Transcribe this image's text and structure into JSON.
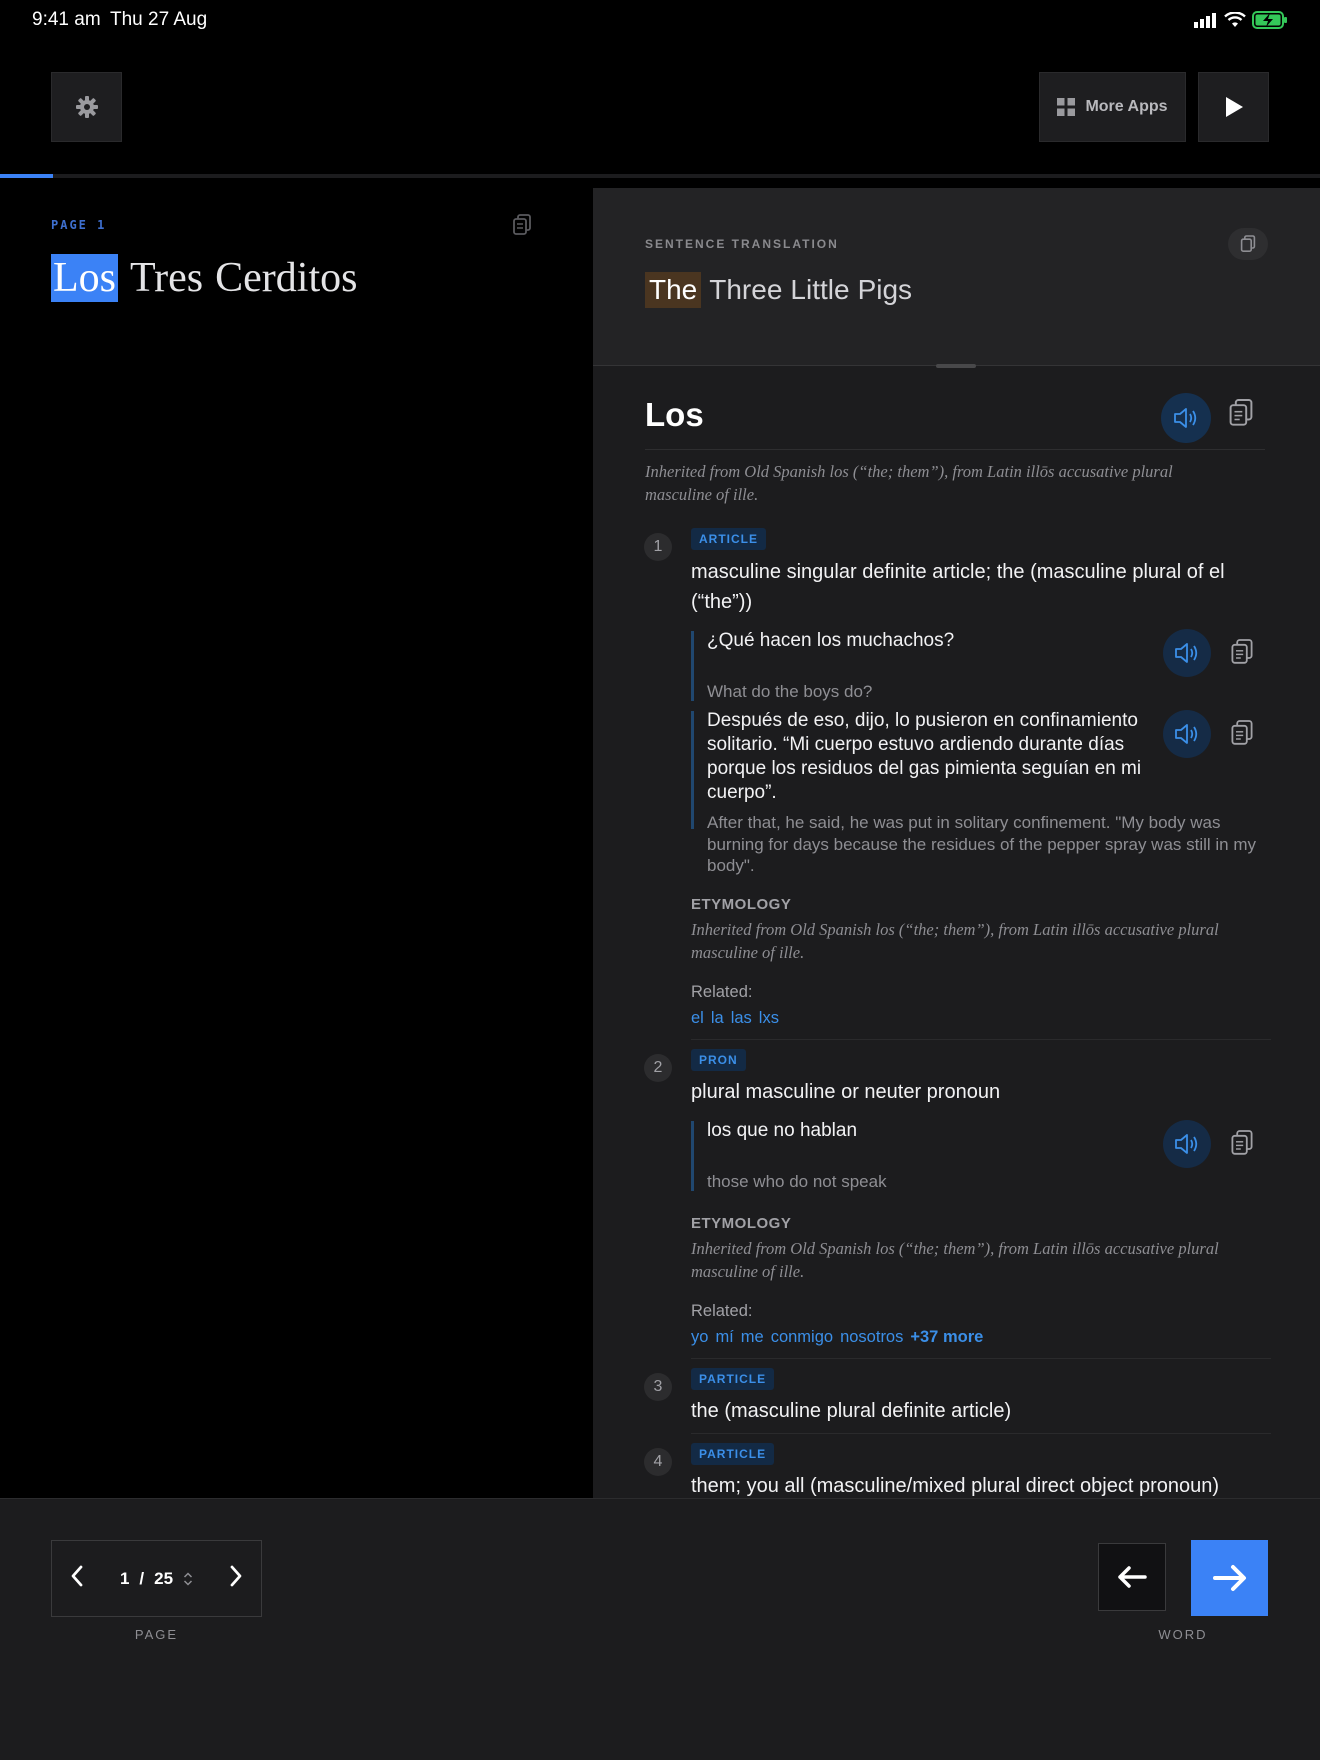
{
  "status_bar": {
    "time": "9:41 am",
    "date": "Thu 27 Aug"
  },
  "toolbar": {
    "more_apps_label": "More Apps"
  },
  "reader": {
    "progress_fraction": 0.04,
    "page_label": "PAGE 1",
    "title_words": [
      "Los",
      "Tres",
      "Cerditos"
    ]
  },
  "translation": {
    "label": "SENTENCE TRANSLATION",
    "words": [
      "The",
      "Three",
      "Little",
      "Pigs"
    ]
  },
  "word": {
    "headword": "Los",
    "etymology": "Inherited from Old Spanish los (“the; them”), from Latin illōs accusative plural masculine of ille.",
    "senses": [
      {
        "number": "1",
        "pos": "ARTICLE",
        "definition": "masculine singular definite article; the (masculine plural of el (“the”))",
        "examples": [
          {
            "text": "¿Qué hacen los muchachos?",
            "translation": "What do the boys do?"
          },
          {
            "text": "Después de eso, dijo, lo pusieron en confinamiento solitario. “Mi cuerpo estuvo ardiendo durante días porque los residuos del gas pimienta seguían en mi cuerpo”.",
            "translation": "After that, he said, he was put in solitary confinement. \"My body was burning for days because the residues of the pepper spray was still in my body\"."
          }
        ],
        "etymology_heading": "ETYMOLOGY",
        "etymology": "Inherited from Old Spanish los (“the; them”), from Latin illōs accusative plural masculine of ille.",
        "related_label": "Related:",
        "related": [
          "el",
          "la",
          "las",
          "lxs"
        ]
      },
      {
        "number": "2",
        "pos": "PRON",
        "definition": "plural masculine or neuter pronoun",
        "examples": [
          {
            "text": "los que no hablan",
            "translation": "those who do not speak"
          }
        ],
        "etymology_heading": "ETYMOLOGY",
        "etymology": "Inherited from Old Spanish los (“the; them”), from Latin illōs accusative plural masculine of ille.",
        "related_label": "Related:",
        "related": [
          "yo",
          "mí",
          "me",
          "conmigo",
          "nosotros"
        ],
        "related_more": "+37 more"
      },
      {
        "number": "3",
        "pos": "PARTICLE",
        "definition": "the (masculine plural definite article)"
      },
      {
        "number": "4",
        "pos": "PARTICLE",
        "definition": "them; you all (masculine/mixed plural direct object pronoun)"
      }
    ]
  },
  "bottom": {
    "current_page": "1",
    "separator": "/",
    "total_pages": "25",
    "page_label": "PAGE",
    "word_label": "WORD"
  },
  "colors": {
    "accent": "#3b82f6",
    "translation_highlight": "#4a3520",
    "panel": "#1c1c1e"
  }
}
